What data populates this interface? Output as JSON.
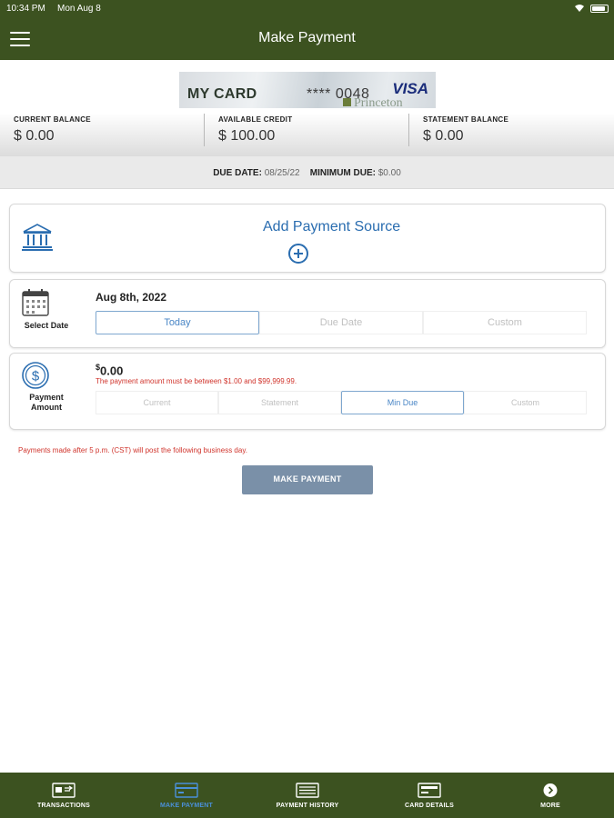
{
  "status_bar": {
    "time": "10:34 PM",
    "date": "Mon Aug 8"
  },
  "header": {
    "title": "Make Payment"
  },
  "card": {
    "name": "MY CARD",
    "masked_number": "**** 0048",
    "brand": "VISA",
    "bank": "Princeton"
  },
  "balances": [
    {
      "label": "CURRENT BALANCE",
      "value": "$ 0.00"
    },
    {
      "label": "AVAILABLE CREDIT",
      "value": "$ 100.00"
    },
    {
      "label": "STATEMENT BALANCE",
      "value": "$ 0.00"
    }
  ],
  "due": {
    "due_label": "DUE DATE:",
    "due_value": "08/25/22",
    "min_label": "MINIMUM DUE:",
    "min_value": "$0.00"
  },
  "payment_source": {
    "add_label": "Add Payment Source"
  },
  "select_date": {
    "label": "Select Date",
    "value": "Aug 8th, 2022",
    "options": [
      "Today",
      "Due Date",
      "Custom"
    ],
    "selected": "Today"
  },
  "payment_amount": {
    "label_line1": "Payment",
    "label_line2": "Amount",
    "currency": "$",
    "value": "0.00",
    "error": "The payment amount must be between $1.00 and $99,999.99.",
    "options": [
      "Current",
      "Statement",
      "Min Due",
      "Custom"
    ],
    "selected": "Min Due"
  },
  "notice": "Payments made after 5 p.m. (CST) will post the following business day.",
  "make_payment_button": "MAKE PAYMENT",
  "bottom_nav": [
    {
      "label": "TRANSACTIONS",
      "icon": "transactions-icon",
      "active": false
    },
    {
      "label": "MAKE PAYMENT",
      "icon": "make-payment-icon",
      "active": true
    },
    {
      "label": "PAYMENT HISTORY",
      "icon": "payment-history-icon",
      "active": false
    },
    {
      "label": "CARD DETAILS",
      "icon": "card-details-icon",
      "active": false
    },
    {
      "label": "MORE",
      "icon": "more-icon",
      "active": false
    }
  ],
  "colors": {
    "brand_green": "#3c5220",
    "accent_blue": "#2a6db0",
    "error_red": "#d0342c",
    "button_gray_blue": "#7a90a8"
  }
}
